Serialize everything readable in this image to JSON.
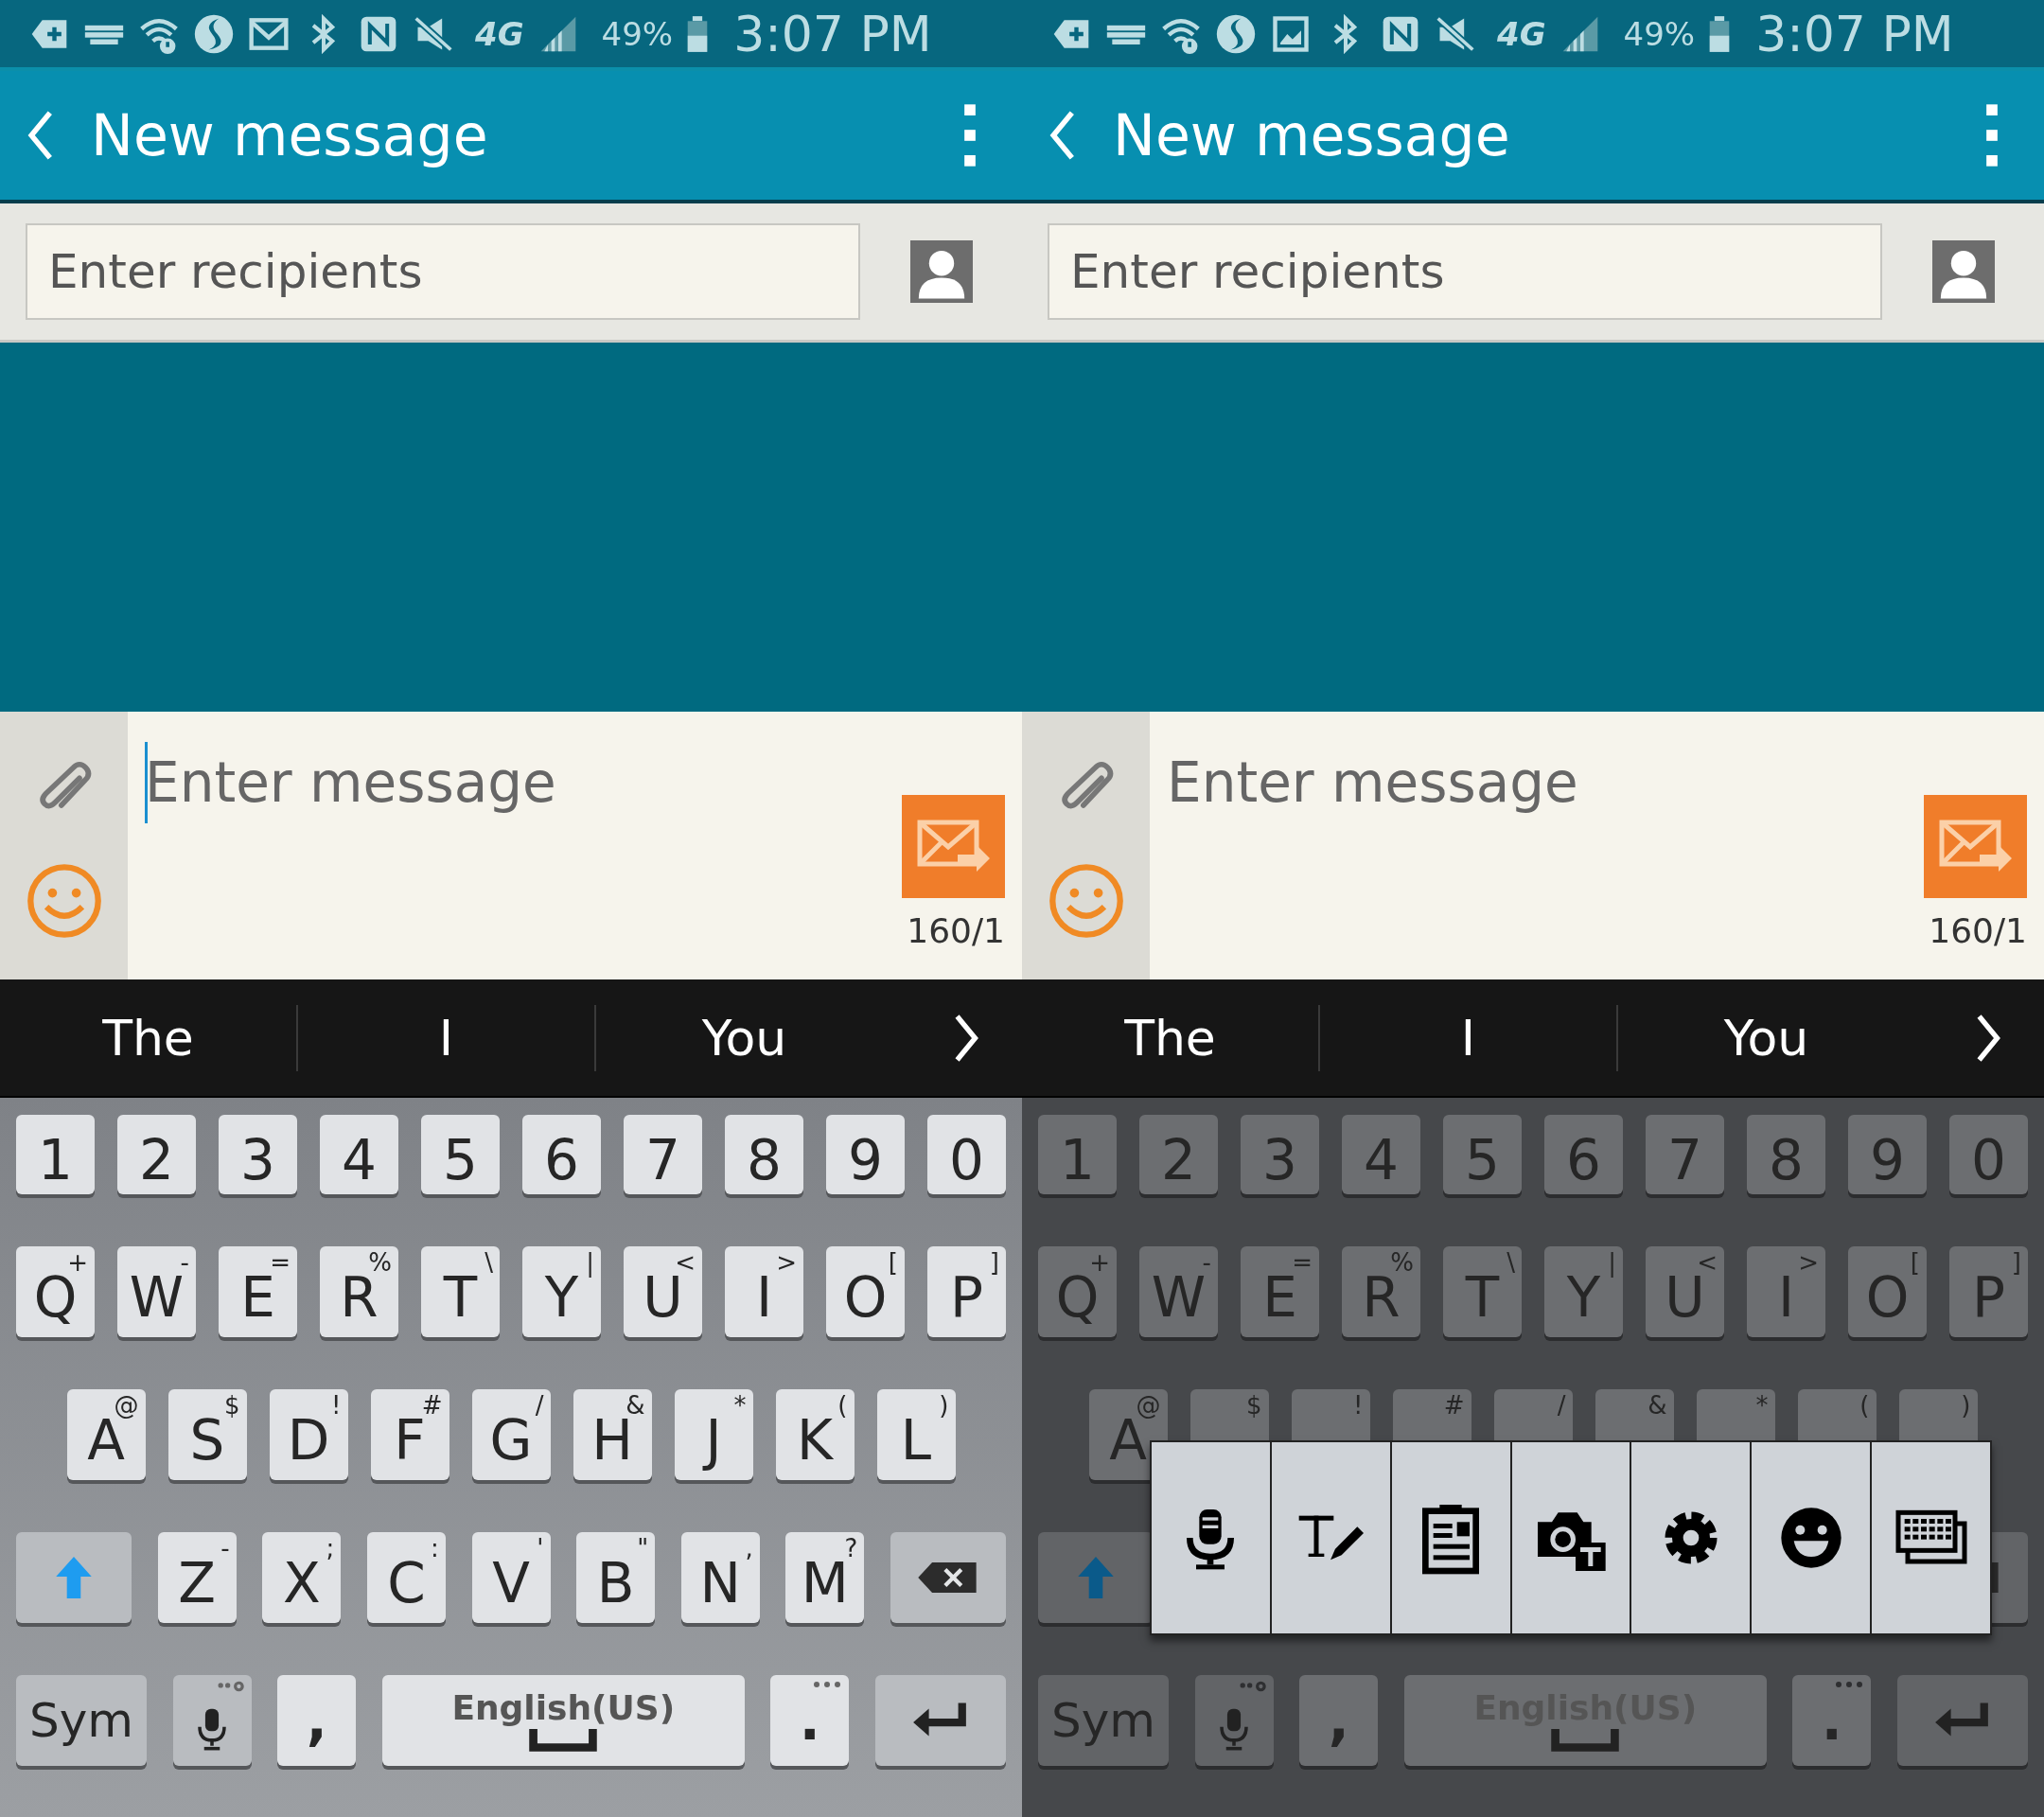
{
  "screens": [
    {
      "status_bar": {
        "icons": [
          {
            "kind": "add-tab"
          },
          {
            "kind": "keyboard"
          },
          {
            "kind": "wifi"
          },
          {
            "kind": "s-logo"
          },
          {
            "kind": "mail"
          },
          {
            "kind": "bluetooth"
          },
          {
            "kind": "nfc"
          },
          {
            "kind": "mute"
          }
        ],
        "network": "4G",
        "battery": "49%",
        "time": "3:07 PM"
      },
      "header": {
        "title": "New message"
      },
      "recipients": {
        "placeholder": "Enter recipients"
      },
      "composer": {
        "placeholder": "Enter message",
        "focused": true,
        "counter": "160/1"
      },
      "suggestions": [
        "The",
        "I",
        "You"
      ],
      "keyboard": {
        "dimmed": false,
        "rows": [
          {
            "keys": [
              {
                "kind": "key",
                "label": "1"
              },
              {
                "kind": "key",
                "label": "2"
              },
              {
                "kind": "key",
                "label": "3"
              },
              {
                "kind": "key",
                "label": "4"
              },
              {
                "kind": "key",
                "label": "5"
              },
              {
                "kind": "key",
                "label": "6"
              },
              {
                "kind": "key",
                "label": "7"
              },
              {
                "kind": "key",
                "label": "8"
              },
              {
                "kind": "key",
                "label": "9"
              },
              {
                "kind": "key",
                "label": "0"
              }
            ]
          },
          {
            "keys": [
              {
                "kind": "key",
                "label": "Q",
                "symbol": "+"
              },
              {
                "kind": "key",
                "label": "W",
                "symbol": "-"
              },
              {
                "kind": "key",
                "label": "E",
                "symbol": "="
              },
              {
                "kind": "key",
                "label": "R",
                "symbol": "%"
              },
              {
                "kind": "key",
                "label": "T",
                "symbol": "\\"
              },
              {
                "kind": "key",
                "label": "Y",
                "symbol": "|"
              },
              {
                "kind": "key",
                "label": "U",
                "symbol": "<"
              },
              {
                "kind": "key",
                "label": "I",
                "symbol": ">"
              },
              {
                "kind": "key",
                "label": "O",
                "symbol": "["
              },
              {
                "kind": "key",
                "label": "P",
                "symbol": "]"
              }
            ]
          },
          {
            "keys": [
              {
                "kind": "key",
                "label": "A",
                "symbol": "@"
              },
              {
                "kind": "key",
                "label": "S",
                "symbol": "$"
              },
              {
                "kind": "key",
                "label": "D",
                "symbol": "!"
              },
              {
                "kind": "key",
                "label": "F",
                "symbol": "#"
              },
              {
                "kind": "key",
                "label": "G",
                "symbol": "/"
              },
              {
                "kind": "key",
                "label": "H",
                "symbol": "&"
              },
              {
                "kind": "key",
                "label": "J",
                "symbol": "*"
              },
              {
                "kind": "key",
                "label": "K",
                "symbol": "("
              },
              {
                "kind": "key",
                "label": "L",
                "symbol": ")"
              }
            ]
          },
          {
            "keys": [
              {
                "kind": "shift"
              },
              {
                "kind": "key",
                "label": "Z",
                "symbol": "-"
              },
              {
                "kind": "key",
                "label": "X",
                "symbol": ";"
              },
              {
                "kind": "key",
                "label": "C",
                "symbol": ":"
              },
              {
                "kind": "key",
                "label": "V",
                "symbol": "'"
              },
              {
                "kind": "key",
                "label": "B",
                "symbol": "\""
              },
              {
                "kind": "key",
                "label": "N",
                "symbol": ","
              },
              {
                "kind": "key",
                "label": "M",
                "symbol": "?"
              },
              {
                "kind": "delete"
              }
            ]
          },
          {
            "keys": [
              {
                "kind": "sym",
                "label": "Sym"
              },
              {
                "kind": "mic"
              },
              {
                "kind": "comma",
                "label": ","
              },
              {
                "kind": "space",
                "label": "English(US)"
              },
              {
                "kind": "period",
                "label": "."
              },
              {
                "kind": "enter"
              }
            ]
          }
        ]
      }
    },
    {
      "status_bar": {
        "icons": [
          {
            "kind": "add-tab"
          },
          {
            "kind": "keyboard"
          },
          {
            "kind": "wifi"
          },
          {
            "kind": "s-logo"
          },
          {
            "kind": "picture"
          },
          {
            "kind": "bluetooth"
          },
          {
            "kind": "nfc"
          },
          {
            "kind": "mute"
          }
        ],
        "network": "4G",
        "battery": "49%",
        "time": "3:07 PM"
      },
      "header": {
        "title": "New message"
      },
      "recipients": {
        "placeholder": "Enter recipients"
      },
      "composer": {
        "placeholder": "Enter message",
        "focused": false,
        "counter": "160/1"
      },
      "suggestions": [
        "The",
        "I",
        "You"
      ],
      "keyboard": {
        "dimmed": true,
        "rows": [
          {
            "keys": [
              {
                "kind": "key",
                "label": "1"
              },
              {
                "kind": "key",
                "label": "2"
              },
              {
                "kind": "key",
                "label": "3"
              },
              {
                "kind": "key",
                "label": "4"
              },
              {
                "kind": "key",
                "label": "5"
              },
              {
                "kind": "key",
                "label": "6"
              },
              {
                "kind": "key",
                "label": "7"
              },
              {
                "kind": "key",
                "label": "8"
              },
              {
                "kind": "key",
                "label": "9"
              },
              {
                "kind": "key",
                "label": "0"
              }
            ]
          },
          {
            "keys": [
              {
                "kind": "key",
                "label": "Q",
                "symbol": "+"
              },
              {
                "kind": "key",
                "label": "W",
                "symbol": "-"
              },
              {
                "kind": "key",
                "label": "E",
                "symbol": "="
              },
              {
                "kind": "key",
                "label": "R",
                "symbol": "%"
              },
              {
                "kind": "key",
                "label": "T",
                "symbol": "\\"
              },
              {
                "kind": "key",
                "label": "Y",
                "symbol": "|"
              },
              {
                "kind": "key",
                "label": "U",
                "symbol": "<"
              },
              {
                "kind": "key",
                "label": "I",
                "symbol": ">"
              },
              {
                "kind": "key",
                "label": "O",
                "symbol": "["
              },
              {
                "kind": "key",
                "label": "P",
                "symbol": "]"
              }
            ]
          },
          {
            "keys": [
              {
                "kind": "key",
                "label": "A",
                "symbol": "@"
              },
              {
                "kind": "key",
                "symbol": "$"
              },
              {
                "kind": "key",
                "symbol": "!"
              },
              {
                "kind": "key",
                "symbol": "#"
              },
              {
                "kind": "key",
                "symbol": "/"
              },
              {
                "kind": "key",
                "symbol": "&"
              },
              {
                "kind": "key",
                "symbol": "*"
              },
              {
                "kind": "key",
                "symbol": "("
              },
              {
                "kind": "key",
                "symbol": ")"
              }
            ]
          },
          {
            "keys": [
              {
                "kind": "shift"
              },
              {
                "kind": "delete"
              }
            ]
          },
          {
            "keys": [
              {
                "kind": "sym",
                "label": "Sym"
              },
              {
                "kind": "mic"
              },
              {
                "kind": "comma",
                "label": ","
              },
              {
                "kind": "space",
                "label": "English(US)"
              },
              {
                "kind": "period",
                "label": "."
              },
              {
                "kind": "enter"
              }
            ]
          }
        ]
      },
      "popup": {
        "items": [
          {
            "kind": "voice"
          },
          {
            "kind": "handwriting"
          },
          {
            "kind": "clipboard"
          },
          {
            "kind": "camera-text"
          },
          {
            "kind": "settings"
          },
          {
            "kind": "emoji"
          },
          {
            "kind": "keyboard"
          }
        ]
      }
    }
  ]
}
